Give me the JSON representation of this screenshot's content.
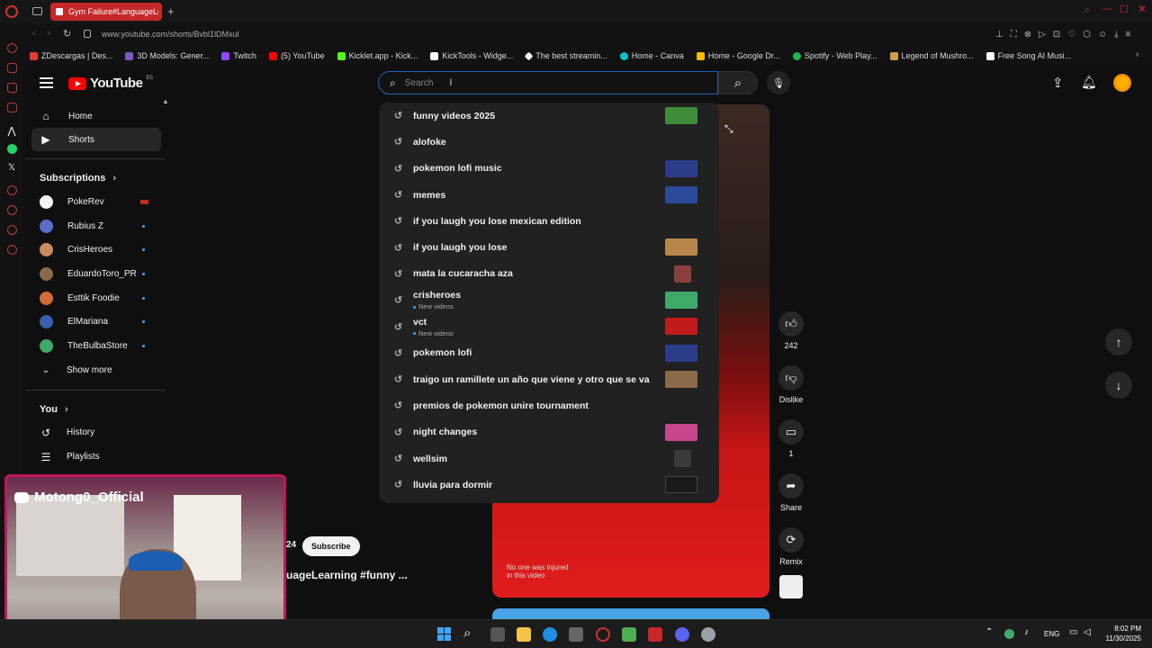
{
  "browser": {
    "tab_title": "Gym Failure#LanguageLe",
    "url": "www.youtube.com/shorts/Bvbl1lDMxul",
    "bookmarks": [
      {
        "label": "ZDescargas | Des...",
        "color": "#e53935"
      },
      {
        "label": "3D Models: Gener...",
        "color": "#7e57c2"
      },
      {
        "label": "Twitch",
        "color": "#9146ff"
      },
      {
        "label": "(5) YouTube",
        "color": "#ff0000"
      },
      {
        "label": "Kicklet.app - Kick...",
        "color": "#53fc18"
      },
      {
        "label": "KickTools - Widge...",
        "color": "#ffffff"
      },
      {
        "label": "The best streamin...",
        "color": "#ffffff"
      },
      {
        "label": "Home - Canva",
        "color": "#00c4cc"
      },
      {
        "label": "Home - Google Dr...",
        "color": "#fbbc04"
      },
      {
        "label": "Spotify - Web Play...",
        "color": "#1db954"
      },
      {
        "label": "Legend of Mushro...",
        "color": "#c8a24a"
      },
      {
        "label": "Free Song AI Musi...",
        "color": "#ffffff"
      }
    ]
  },
  "youtube": {
    "logo_text": "YouTube",
    "logo_region": "ES",
    "search_placeholder": "Search"
  },
  "sidebar": {
    "home": "Home",
    "shorts": "Shorts",
    "subscriptions_header": "Subscriptions",
    "subscriptions": [
      {
        "name": "PokeRev",
        "avatar_color": "#f5f5f5",
        "badge": "live"
      },
      {
        "name": "Rubius Z",
        "avatar_color": "#5b6cc9",
        "badge": "dot"
      },
      {
        "name": "CrisHeroes",
        "avatar_color": "#c98b60",
        "badge": "dot"
      },
      {
        "name": "EduardoToro_PR",
        "avatar_color": "#8a6a4a",
        "badge": "dot"
      },
      {
        "name": "Esttik Foodie",
        "avatar_color": "#d36b3a",
        "badge": "dot"
      },
      {
        "name": "ElMariana",
        "avatar_color": "#3b5fae",
        "badge": "dot"
      },
      {
        "name": "TheBulbaStore",
        "avatar_color": "#3fa96a",
        "badge": "dot"
      }
    ],
    "show_more": "Show more",
    "you_header": "You",
    "history": "History",
    "playlists": "Playlists"
  },
  "suggestions": [
    {
      "text": "funny videos 2025",
      "sub": "",
      "thumb": "#3f8d3a"
    },
    {
      "text": "alofoke",
      "sub": "",
      "thumb": ""
    },
    {
      "text": "pokemon lofi music",
      "sub": "",
      "thumb": "#2b3d8a"
    },
    {
      "text": "memes",
      "sub": "",
      "thumb": "#2c4a9b"
    },
    {
      "text": "if you laugh you lose mexican edition",
      "sub": "",
      "thumb": ""
    },
    {
      "text": "if you laugh you lose",
      "sub": "",
      "thumb": "#b8864a"
    },
    {
      "text": "mata la cucaracha aza",
      "sub": "",
      "thumb": "#8a3f3f"
    },
    {
      "text": "crisheroes",
      "sub": "New videos",
      "thumb": "#3fa96a"
    },
    {
      "text": "vct",
      "sub": "New videos",
      "thumb": "#c21b1b"
    },
    {
      "text": "pokemon lofi",
      "sub": "",
      "thumb": "#2b3d8a"
    },
    {
      "text": "traigo un ramillete un año que viene y otro que se va",
      "sub": "",
      "thumb": "#8a6a4a"
    },
    {
      "text": "premios de pokemon unire tournament",
      "sub": "",
      "thumb": ""
    },
    {
      "text": "night changes",
      "sub": "",
      "thumb": "#c8468a"
    },
    {
      "text": "wellsim",
      "sub": "",
      "thumb": "#3a3a3a"
    },
    {
      "text": "lluvia para dormir",
      "sub": "",
      "thumb": "#1a1a1a"
    }
  ],
  "short": {
    "caption": "No one was injured in this video",
    "channel_subs_fragment": "24",
    "subscribe_label": "Subscribe",
    "title_fragment": "uageLearning #funny ..."
  },
  "actions": {
    "likes": "242",
    "dislike_label": "Dislike",
    "comments": "1",
    "share_label": "Share",
    "remix_label": "Remix"
  },
  "webcam": {
    "discord_name": "Motong0_Official"
  },
  "taskbar": {
    "language": "ENG",
    "time": "8:02 PM",
    "date": "11/30/2025"
  }
}
